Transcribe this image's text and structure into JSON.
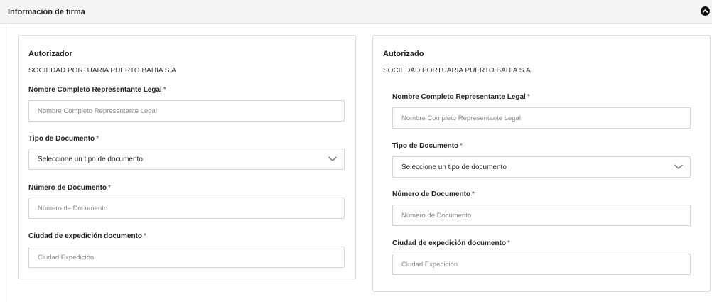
{
  "panel": {
    "title": "Información de firma"
  },
  "left_card": {
    "role": "Autorizador",
    "company": "SOCIEDAD PORTUARIA PUERTO BAHIA S.A",
    "fields": {
      "name_label": "Nombre Completo Representante Legal",
      "name_placeholder": "Nombre Completo Representante Legal",
      "doc_type_label": "Tipo de Documento",
      "doc_type_value": "Seleccione un tipo de documento",
      "doc_number_label": "Número de Documento",
      "doc_number_placeholder": "Número de Documento",
      "city_label": "Ciudad de expedición documento",
      "city_placeholder": "Ciudad Expedición"
    }
  },
  "right_card": {
    "role": "Autorizado",
    "company": "SOCIEDAD PORTUARIA PUERTO BAHIA S.A",
    "fields": {
      "name_label": "Nombre Completo Representante Legal",
      "name_placeholder": "Nombre Completo Representante Legal",
      "doc_type_label": "Tipo de Documento",
      "doc_type_value": "Seleccione un tipo de documento",
      "doc_number_label": "Número de Documento",
      "doc_number_placeholder": "Número de Documento",
      "city_label": "Ciudad de expedición documento",
      "city_placeholder": "Ciudad Expedición"
    }
  },
  "required_mark": "*",
  "icons": {
    "collapse": "chevron-up-circle-icon",
    "dropdown": "chevron-down-icon"
  },
  "colors": {
    "header_bg": "#f5f5f5",
    "border": "#d4d4d4",
    "text": "#222222",
    "placeholder": "#888888"
  }
}
